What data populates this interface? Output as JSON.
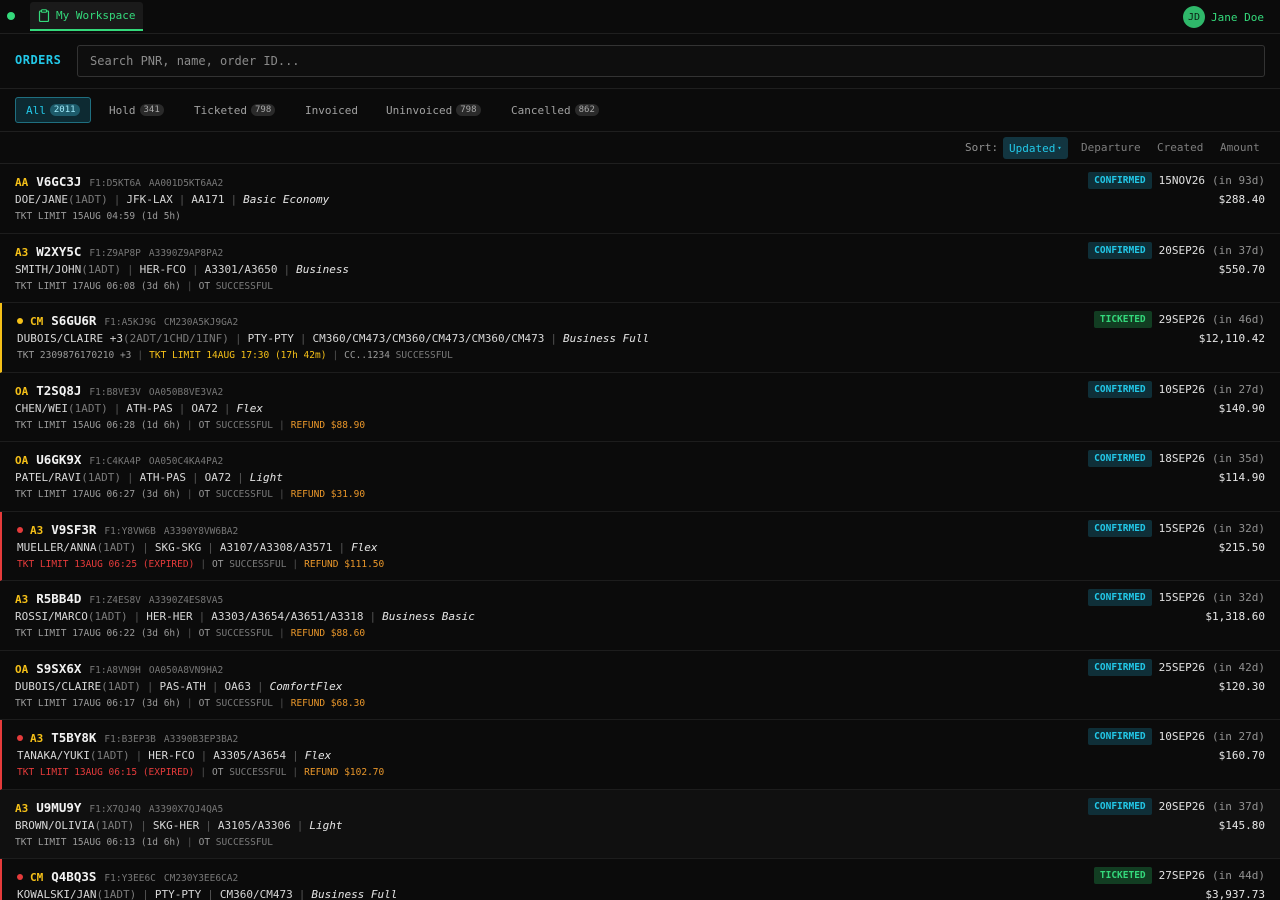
{
  "topbar": {
    "workspace_tab": "My Workspace",
    "user_initials": "JD",
    "user_name": "Jane Doe"
  },
  "search": {
    "title": "ORDERS",
    "placeholder": "Search PNR, name, order ID..."
  },
  "filters": [
    {
      "label": "All",
      "count": "2011",
      "active": true
    },
    {
      "label": "Hold",
      "count": "341"
    },
    {
      "label": "Ticketed",
      "count": "798"
    },
    {
      "label": "Invoiced",
      "count": ""
    },
    {
      "label": "Uninvoiced",
      "count": "798"
    },
    {
      "label": "Cancelled",
      "count": "862"
    }
  ],
  "sort": {
    "label": "Sort:",
    "options": [
      "Updated",
      "Departure",
      "Created",
      "Amount"
    ],
    "active": "Updated"
  },
  "orders": [
    {
      "airline": "AA",
      "pnr": "V6GC3J",
      "meta1": "F1:D5KT6A",
      "meta2": "AA001D5KT6AA2",
      "pax": "DOE/JANE",
      "ptc": "(1ADT)",
      "route": "JFK-LAX",
      "flights": "AA171",
      "fare": "Basic Economy",
      "tkt_limit": "TKT LIMIT 15AUG 04:59 (1d 5h)",
      "ot": "",
      "refund": "",
      "status": "CONFIRMED",
      "date": "15NOV26",
      "in": "(in 93d)",
      "amount": "$288.40",
      "flag": ""
    },
    {
      "airline": "A3",
      "pnr": "W2XY5C",
      "meta1": "F1:Z9AP8P",
      "meta2": "A3390Z9AP8PA2",
      "pax": "SMITH/JOHN",
      "ptc": "(1ADT)",
      "route": "HER-FCO",
      "flights": "A3301/A3650",
      "fare": "Business",
      "tkt_limit": "TKT LIMIT 17AUG 06:08 (3d 6h)",
      "ot": "SUCCESSFUL",
      "refund": "",
      "status": "CONFIRMED",
      "date": "20SEP26",
      "in": "(in 37d)",
      "amount": "$550.70",
      "flag": ""
    },
    {
      "airline": "CM",
      "pnr": "S6GU6R",
      "meta1": "F1:A5KJ9G",
      "meta2": "CM230A5KJ9GA2",
      "pax": "DUBOIS/CLAIRE +3",
      "ptc": "(2ADT/1CHD/1INF)",
      "route": "PTY-PTY",
      "flights": "CM360/CM473/CM360/CM473/CM360/CM473",
      "fare": "Business Full",
      "tkt": "TKT 2309876170210 +3",
      "tkt_limit": "TKT LIMIT 14AUG 17:30 (17h 42m)",
      "cc": "CC..1234",
      "cc_status": "SUCCESSFUL",
      "status": "TICKETED",
      "date": "29SEP26",
      "in": "(in 46d)",
      "amount": "$12,110.42",
      "flag": "warn"
    },
    {
      "airline": "OA",
      "pnr": "T2SQ8J",
      "meta1": "F1:B8VE3V",
      "meta2": "OA050B8VE3VA2",
      "pax": "CHEN/WEI",
      "ptc": "(1ADT)",
      "route": "ATH-PAS",
      "flights": "OA72",
      "fare": "Flex",
      "tkt_limit": "TKT LIMIT 15AUG 06:28 (1d 6h)",
      "ot": "SUCCESSFUL",
      "refund": "REFUND $88.90",
      "status": "CONFIRMED",
      "date": "10SEP26",
      "in": "(in 27d)",
      "amount": "$140.90",
      "flag": ""
    },
    {
      "airline": "OA",
      "pnr": "U6GK9X",
      "meta1": "F1:C4KA4P",
      "meta2": "OA050C4KA4PA2",
      "pax": "PATEL/RAVI",
      "ptc": "(1ADT)",
      "route": "ATH-PAS",
      "flights": "OA72",
      "fare": "Light",
      "tkt_limit": "TKT LIMIT 17AUG 06:27 (3d 6h)",
      "ot": "SUCCESSFUL",
      "refund": "REFUND $31.90",
      "status": "CONFIRMED",
      "date": "18SEP26",
      "in": "(in 35d)",
      "amount": "$114.90",
      "flag": ""
    },
    {
      "airline": "A3",
      "pnr": "V9SF3R",
      "meta1": "F1:Y8VW6B",
      "meta2": "A3390Y8VW6BA2",
      "pax": "MUELLER/ANNA",
      "ptc": "(1ADT)",
      "route": "SKG-SKG",
      "flights": "A3107/A3308/A3571",
      "fare": "Flex",
      "tkt_limit": "TKT LIMIT 13AUG 06:25 (EXPIRED)",
      "ot": "SUCCESSFUL",
      "refund": "REFUND $111.50",
      "status": "CONFIRMED",
      "date": "15SEP26",
      "in": "(in 32d)",
      "amount": "$215.50",
      "flag": "err"
    },
    {
      "airline": "A3",
      "pnr": "R5BB4D",
      "meta1": "F1:Z4ES8V",
      "meta2": "A3390Z4ES8VA5",
      "pax": "ROSSI/MARCO",
      "ptc": "(1ADT)",
      "route": "HER-HER",
      "flights": "A3303/A3654/A3651/A3318",
      "fare": "Business Basic",
      "tkt_limit": "TKT LIMIT 17AUG 06:22 (3d 6h)",
      "ot": "SUCCESSFUL",
      "refund": "REFUND $88.60",
      "status": "CONFIRMED",
      "date": "15SEP26",
      "in": "(in 32d)",
      "amount": "$1,318.60",
      "flag": ""
    },
    {
      "airline": "OA",
      "pnr": "S9SX6X",
      "meta1": "F1:A8VN9H",
      "meta2": "OA050A8VN9HA2",
      "pax": "DUBOIS/CLAIRE",
      "ptc": "(1ADT)",
      "route": "PAS-ATH",
      "flights": "OA63",
      "fare": "ComfortFlex",
      "tkt_limit": "TKT LIMIT 17AUG 06:17 (3d 6h)",
      "ot": "SUCCESSFUL",
      "refund": "REFUND $68.30",
      "status": "CONFIRMED",
      "date": "25SEP26",
      "in": "(in 42d)",
      "amount": "$120.30",
      "flag": ""
    },
    {
      "airline": "A3",
      "pnr": "T5BY8K",
      "meta1": "F1:B3EP3B",
      "meta2": "A3390B3EP3BA2",
      "pax": "TANAKA/YUKI",
      "ptc": "(1ADT)",
      "route": "HER-FCO",
      "flights": "A3305/A3654",
      "fare": "Flex",
      "tkt_limit": "TKT LIMIT 13AUG 06:15 (EXPIRED)",
      "ot": "SUCCESSFUL",
      "refund": "REFUND $102.70",
      "status": "CONFIRMED",
      "date": "10SEP26",
      "in": "(in 27d)",
      "amount": "$160.70",
      "flag": "err"
    },
    {
      "airline": "A3",
      "pnr": "U9MU9Y",
      "meta1": "F1:X7QJ4Q",
      "meta2": "A3390X7QJ4QA5",
      "pax": "BROWN/OLIVIA",
      "ptc": "(1ADT)",
      "route": "SKG-HER",
      "flights": "A3105/A3306",
      "fare": "Light",
      "tkt_limit": "TKT LIMIT 15AUG 06:13 (1d 6h)",
      "ot": "SUCCESSFUL",
      "refund": "",
      "status": "CONFIRMED",
      "date": "20SEP26",
      "in": "(in 37d)",
      "amount": "$145.80",
      "flag": "",
      "alt": true
    },
    {
      "airline": "CM",
      "pnr": "Q4BQ3S",
      "meta1": "F1:Y3EE6C",
      "meta2": "CM230Y3EE6CA2",
      "pax": "KOWALSKI/JAN",
      "ptc": "(1ADT)",
      "route": "PTY-PTY",
      "flights": "CM360/CM473",
      "fare": "Business Full",
      "tkt_limit": "",
      "ot": "",
      "refund": "",
      "status": "TICKETED",
      "date": "27SEP26",
      "in": "(in 44d)",
      "amount": "$3,937.73",
      "flag": "err"
    }
  ],
  "labels": {
    "ot": "OT"
  },
  "colors": {
    "accent": "#22c8e8",
    "green": "#34d97b",
    "yellow": "#f5c018",
    "red": "#e53b3b",
    "orange": "#e8962a"
  },
  "icons": {
    "workspace": "clipboard-icon",
    "status": "status-dot",
    "sort": "caret-down-icon"
  }
}
